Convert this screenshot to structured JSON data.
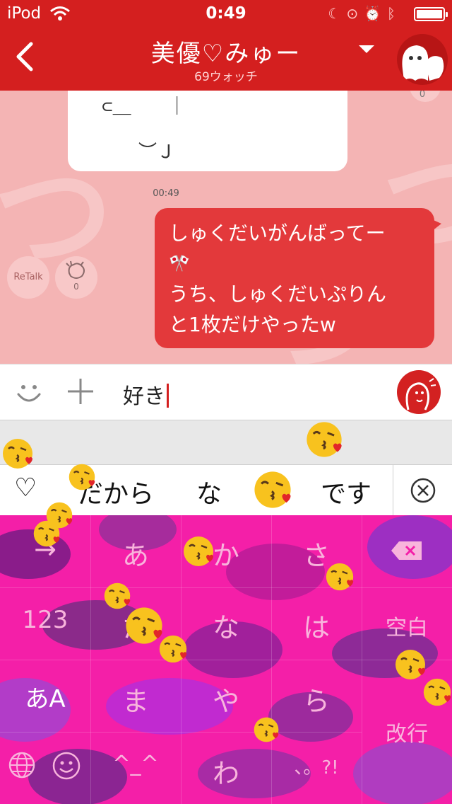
{
  "status_bar": {
    "carrier": "iPod",
    "time": "0:49"
  },
  "nav": {
    "title": "美優♡みゅー",
    "subtitle": "69ウォッチ"
  },
  "chat": {
    "incoming_line1": "⊂＿　　｜",
    "incoming_line2": "　　︶Ｊ",
    "incoming_count": "0",
    "timestamp": "00:49",
    "outgoing_line1": "しゅくだいがんばってー",
    "outgoing_line2": "🎌",
    "outgoing_line3": "うち、しゅくだいぷりん",
    "outgoing_line4": "と1枚だけやったw",
    "retalk_label": "ReTalk",
    "clap_count": "0"
  },
  "input": {
    "text": "好き"
  },
  "suggestions": {
    "heart": "♡",
    "items": [
      "だから",
      "な",
      "",
      "です"
    ]
  },
  "keyboard": {
    "row1": [
      "→",
      "あ",
      "か",
      "さ"
    ],
    "row2": [
      "123",
      "た",
      "な",
      "は",
      "空白"
    ],
    "row3": [
      "あA",
      "ま",
      "や",
      "ら"
    ],
    "row4": [
      "^_^",
      "わ",
      "、。?!"
    ],
    "enter": "改行"
  },
  "colors": {
    "header_red": "#d41f1f",
    "outgoing_bubble": "#e3393b",
    "chat_background": "#f4b4b4",
    "keyboard_pink": "#f41fa8"
  }
}
